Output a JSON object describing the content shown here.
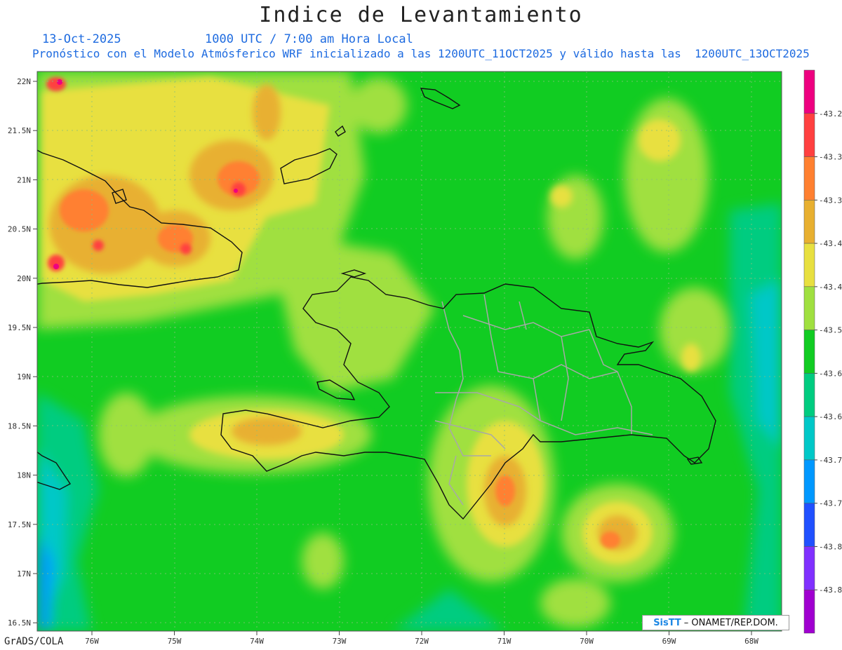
{
  "title": "Indice de Levantamiento",
  "date": "13-Oct-2025",
  "time_label": "1000 UTC / 7:00 am Hora Local",
  "subtitle": "Pronóstico con el Modelo Atmósferico WRF inicializado a las 1200UTC_11OCT2025 y válido hasta las  1200UTC_13OCT2025",
  "credit": "GrADS/COLA",
  "logo": {
    "brand": "SisTT",
    "text": "– ONAMET/REP.DOM."
  },
  "colors": {
    "blue_text": "#1e6be0",
    "base_green": "#11cc22"
  },
  "lat_ticks": [
    "22N",
    "21.5N",
    "21N",
    "20.5N",
    "20N",
    "19.5N",
    "19N",
    "18.5N",
    "18N",
    "17.5N",
    "17N",
    "16.5N"
  ],
  "lon_ticks": [
    "76W",
    "75W",
    "74W",
    "73W",
    "72W",
    "71W",
    "70W",
    "69W",
    "68W"
  ],
  "colorbar": {
    "colors": [
      "#ee0080",
      "#ff4040",
      "#ff8030",
      "#e8b030",
      "#e8e040",
      "#a0e040",
      "#11cc22",
      "#00cc80",
      "#00c8c8",
      "#0098ff",
      "#2050ff",
      "#8030ff",
      "#a000d0"
    ],
    "labels": [
      "-43.2",
      "-43.3",
      "-43.3",
      "-43.4",
      "-43.4",
      "-43.5",
      "-43.6",
      "-43.6",
      "-43.7",
      "-43.7",
      "-43.8",
      "-43.8"
    ]
  }
}
